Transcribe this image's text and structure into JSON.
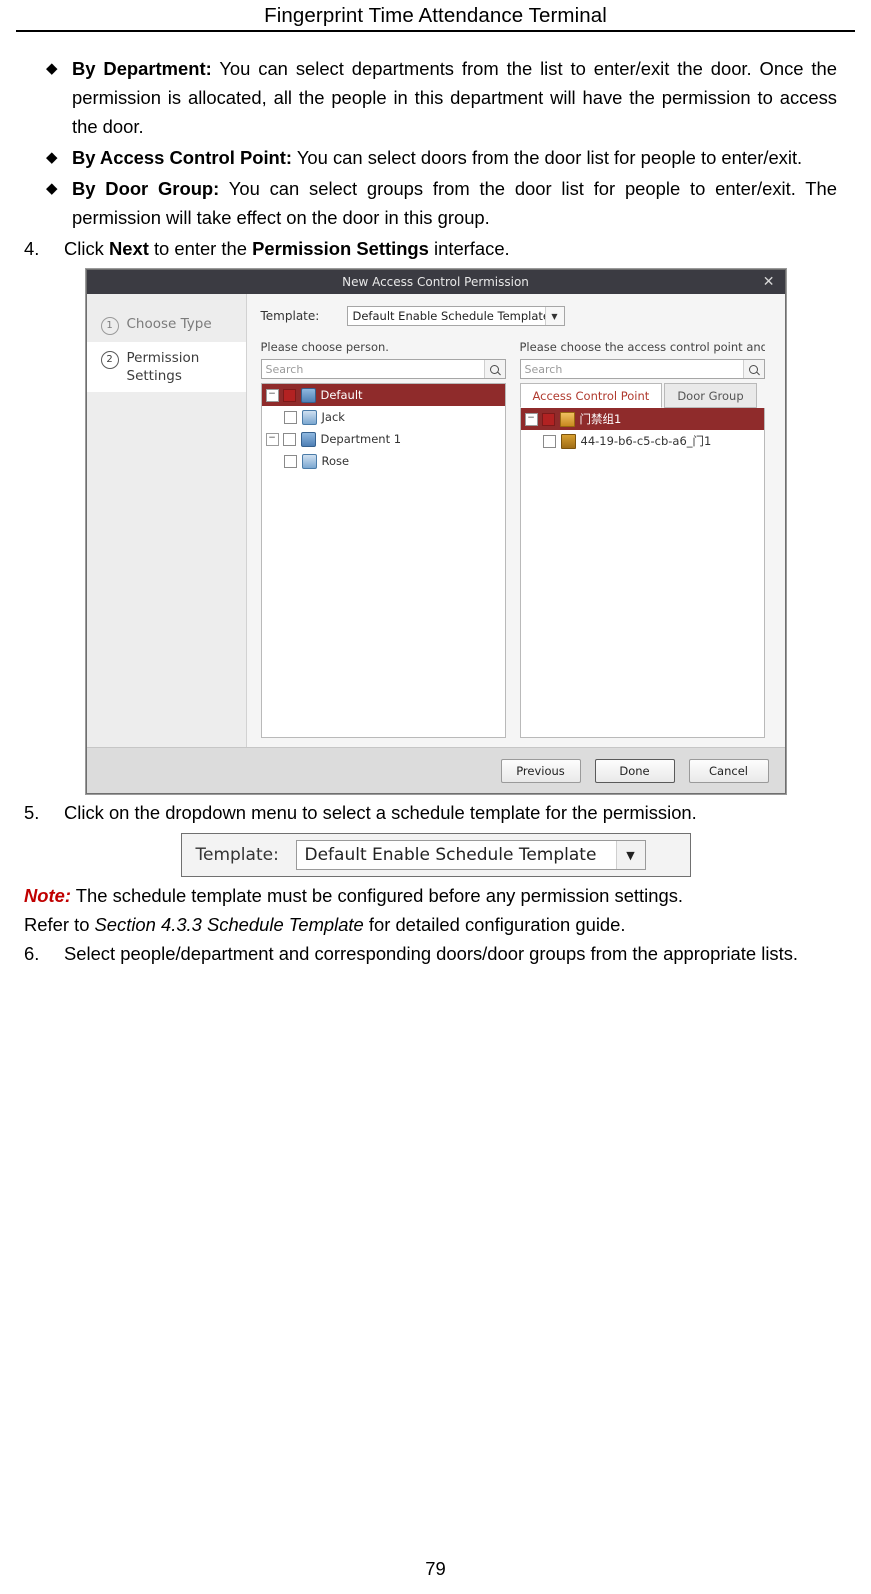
{
  "header": {
    "title": "Fingerprint Time Attendance Terminal"
  },
  "bullets": [
    {
      "mark": "◆",
      "bold": "By Department:",
      "text": " You can select departments from the list to enter/exit the door. Once the permission is allocated, all the people in this department will have the permission to access the door."
    },
    {
      "mark": "◆",
      "bold": "By Access Control Point:",
      "text": " You can select doors from the door list for people to enter/exit."
    },
    {
      "mark": "◆",
      "bold": "By Door Group:",
      "text": " You can select groups from the door list for people to enter/exit. The permission will take effect on the door in this group."
    }
  ],
  "steps": {
    "step4": {
      "num": "4.",
      "pre": "Click ",
      "bold1": "Next",
      "mid": " to enter the ",
      "bold2": "Permission Settings",
      "post": " interface."
    },
    "step5": {
      "num": "5.",
      "text": "Click on the dropdown menu to select a schedule template for the permission."
    },
    "step6": {
      "num": "6.",
      "text": "Select people/department and corresponding doors/door groups from the appropriate lists."
    }
  },
  "note": {
    "label": "Note:",
    "text": " The schedule template must be configured before any permission settings.",
    "line2_pre": "Refer to ",
    "line2_italic": "Section 4.3.3 Schedule Template",
    "line2_post": " for detailed configuration guide."
  },
  "dialog": {
    "title": "New Access Control Permission",
    "close": "✕",
    "nav": [
      {
        "num": "①",
        "label": "Choose Type",
        "active": false
      },
      {
        "num": "②",
        "label": "Permission Settings",
        "active": true
      }
    ],
    "template": {
      "label": "Template:",
      "value": "Default Enable Schedule Template",
      "arrow": "▼"
    },
    "left_panel": {
      "caption": "Please choose person.",
      "search_placeholder": "Search",
      "nodes": [
        {
          "label": "Default",
          "level": 0,
          "selected": true,
          "expander": "−",
          "checkbox": "checked",
          "icon": "people-icon"
        },
        {
          "label": "Jack",
          "level": 1,
          "selected": false,
          "expander": "",
          "checkbox": "empty",
          "icon": "person-icon"
        },
        {
          "label": "Department 1",
          "level": 0,
          "selected": false,
          "expander": "−",
          "checkbox": "empty",
          "icon": "people-icon"
        },
        {
          "label": "Rose",
          "level": 1,
          "selected": false,
          "expander": "",
          "checkbox": "empty",
          "icon": "person-icon"
        }
      ]
    },
    "right_panel": {
      "caption": "Please choose the access control point and the...",
      "search_placeholder": "Search",
      "tabs": [
        {
          "label": "Access Control Point",
          "active": true
        },
        {
          "label": "Door Group",
          "active": false
        }
      ],
      "nodes": [
        {
          "label": "门禁组1",
          "level": 0,
          "selected": true,
          "expander": "−",
          "checkbox": "checked",
          "icon": "door-group-icon"
        },
        {
          "label": "44-19-b6-c5-cb-a6_门1",
          "level": 1,
          "selected": false,
          "expander": "",
          "checkbox": "empty",
          "icon": "device-icon"
        }
      ]
    },
    "buttons": [
      {
        "label": "Previous"
      },
      {
        "label": "Done"
      },
      {
        "label": "Cancel"
      }
    ]
  },
  "template_zoom": {
    "label": "Template:",
    "value": "Default Enable Schedule Template",
    "arrow": "▼"
  },
  "page_number": "79",
  "colors": {
    "note_red": "#c00000",
    "selection": "#8f2b2b",
    "titlebar": "#3b3b42"
  }
}
